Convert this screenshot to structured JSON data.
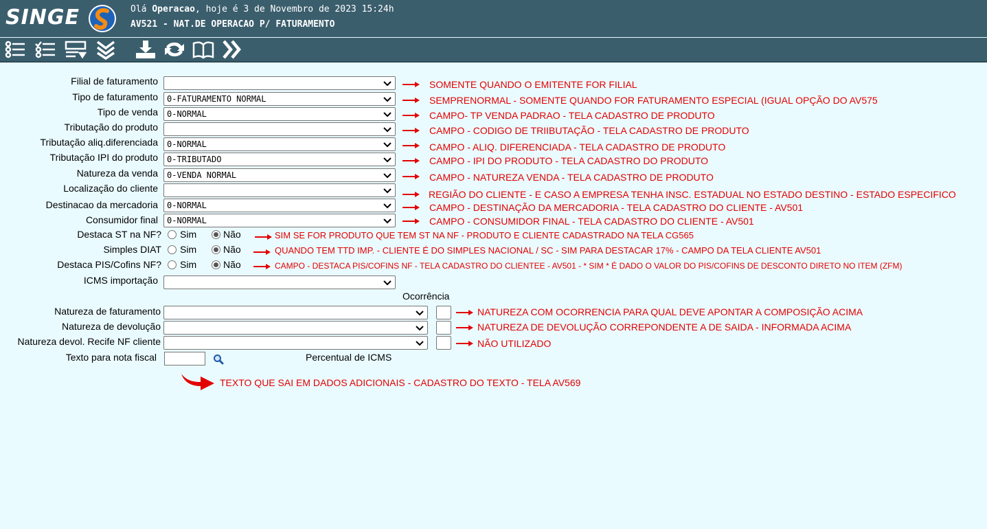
{
  "app": {
    "logo": "SINGE",
    "greeting_prefix": "Olá ",
    "user": "Operacao",
    "greeting_suffix": ", hoje é 3 de Novembro de 2023 15:24h",
    "screen_title": "AV521 - NAT.DE OPERACAO P/ FATURAMENTO"
  },
  "toolbar": {
    "icons": [
      "list-check-icon",
      "list-check-icon",
      "form-icon",
      "chevrons-down-icon",
      "download-icon",
      "refresh-icon",
      "book-icon",
      "chevrons-right-icon"
    ]
  },
  "form": {
    "fields": [
      {
        "label": "Filial de faturamento",
        "value": "",
        "note": "SOMENTE QUANDO O EMITENTE FOR FILIAL"
      },
      {
        "label": "Tipo de faturamento",
        "value": "0-FATURAMENTO NORMAL",
        "note": "SEMPRENORMAL - SOMENTE QUANDO FOR FATURAMENTO ESPECIAL (IGUAL OPÇÃO DO AV575"
      },
      {
        "label": "Tipo de venda",
        "value": "0-NORMAL",
        "note": "CAMPO- TP VENDA PADRAO - TELA CADASTRO DE PRODUTO"
      },
      {
        "label": "Tributação do produto",
        "value": "",
        "note": "CAMPO - CODIGO DE TRIIBUTAÇÃO - TELA CADASTRO DE PRODUTO"
      },
      {
        "label": "Tributação aliq.diferenciada",
        "value": "0-NORMAL",
        "note": "CAMPO - ALIQ. DIFERENCIADA - TELA CADASTRO DE PRODUTO"
      },
      {
        "label": "Tributação IPI do produto",
        "value": "0-TRIBUTADO",
        "note": "CAMPO - IPI DO PRODUTO - TELA CADASTRO DO PRODUTO"
      },
      {
        "label": "Natureza da venda",
        "value": "0-VENDA NORMAL",
        "note": "CAMPO - NATUREZA VENDA - TELA CADASTRO DE PRODUTO"
      },
      {
        "label": "Localização do cliente",
        "value": "",
        "note": "REGIÃO DO CLIENTE - E CASO  A  EMPRESA TENHA INSC. ESTADUAL NO ESTADO DESTINO - ESTADO ESPECIFICO"
      },
      {
        "label": "Destinacao da mercadoria",
        "value": "0-NORMAL",
        "note": "CAMPO - DESTINAÇÃO DA MERCADORIA - TELA CADASTRO DO CLIENTE - AV501"
      },
      {
        "label": "Consumidor final",
        "value": "0-NORMAL",
        "note": "CAMPO - CONSUMIDOR FINAL - TELA CADASTRO DO CLIENTE - AV501"
      }
    ],
    "radios": [
      {
        "label": "Destaca ST na NF?",
        "yes": "Sim",
        "no": "Não",
        "note": "SIM SE FOR PRODUTO QUE TEM ST NA NF - PRODUTO E CLIENTE CADASTRADO NA TELA CG565"
      },
      {
        "label": "Simples DIAT",
        "yes": "Sim",
        "no": "Não",
        "note": "QUANDO TEM TTD IMP. - CLIENTE É DO SIMPLES NACIONAL / SC - SIM PARA DESTACAR 17% - CAMPO DA TELA CLIENTE AV501"
      },
      {
        "label": "Destaca PIS/Cofins NF?",
        "yes": "Sim",
        "no": "Não",
        "note": "CAMPO - DESTACA PIS/COFINS NF - TELA CADASTRO DO CLIENTEE - AV501 - * SIM * É DADO O VALOR DO PIS/COFINS DE DESCONTO DIRETO NO ITEM (ZFM)"
      }
    ],
    "icms_importacao": {
      "label": "ICMS importação",
      "value": ""
    },
    "ocorrencia_header": "Ocorrência",
    "naturezas": [
      {
        "label": "Natureza de faturamento",
        "value": "",
        "note": "NATUREZA COM OCORRENCIA PARA QUAL DEVE APONTAR A COMPOSIÇÃO ACIMA"
      },
      {
        "label": "Natureza de devolução",
        "value": "",
        "note": "NATUREZA DE DEVOLUÇÃO CORREPONDENTE A DE SAIDA - INFORMADA ACIMA"
      },
      {
        "label": "Natureza devol. Recife NF cliente",
        "value": "",
        "note": "NÃO UTILIZADO"
      }
    ],
    "texto_nota": {
      "label": "Texto para nota fiscal",
      "value": "",
      "percentual_label": "Percentual de ICMS",
      "note": "TEXTO QUE SAI EM DADOS ADICIONAIS - CADASTRO DO TEXTO - TELA AV569"
    }
  },
  "colors": {
    "header": "#3b5e6d",
    "background": "#eafbff",
    "note": "#e30000"
  }
}
